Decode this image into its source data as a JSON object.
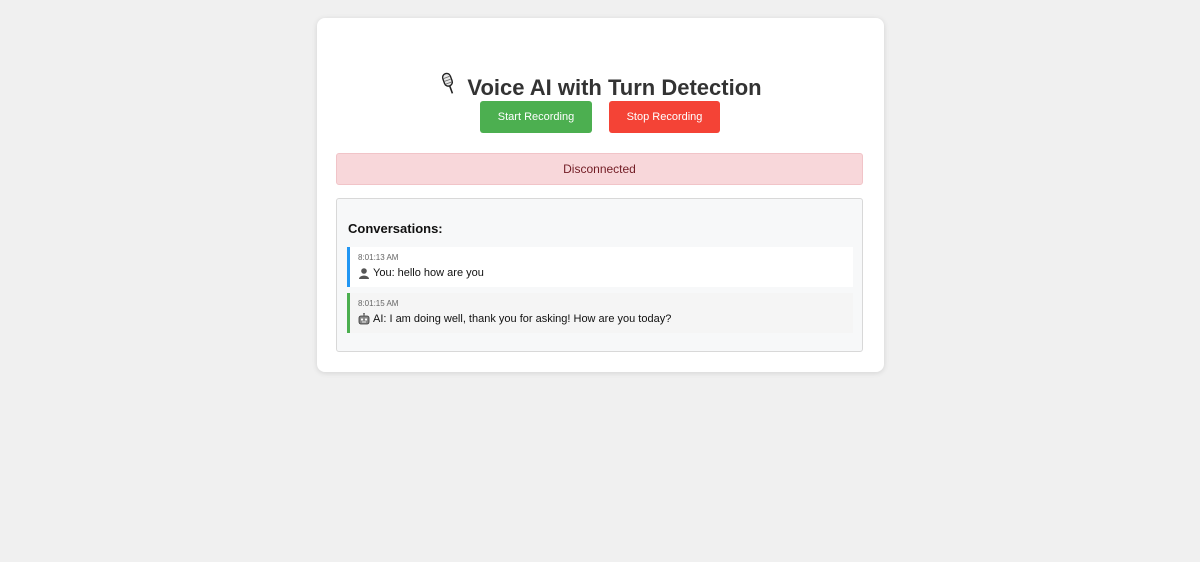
{
  "header": {
    "title": "Voice AI with Turn Detection",
    "icon": "microphone-icon"
  },
  "controls": {
    "start_label": "Start Recording",
    "stop_label": "Stop Recording",
    "start_color": "#4caf50",
    "stop_color": "#f44336"
  },
  "status": {
    "text": "Disconnected",
    "background": "#f8d7da"
  },
  "conversation": {
    "heading": "Conversations:",
    "messages": [
      {
        "time": "8:01:13 AM",
        "sender": "You:",
        "text": "hello how are you",
        "icon": "user-icon",
        "accent": "#2196f3"
      },
      {
        "time": "8:01:15 AM",
        "sender": "AI:",
        "text": "I am doing well, thank you for asking! How are you today?",
        "icon": "robot-icon",
        "accent": "#4caf50"
      }
    ]
  }
}
